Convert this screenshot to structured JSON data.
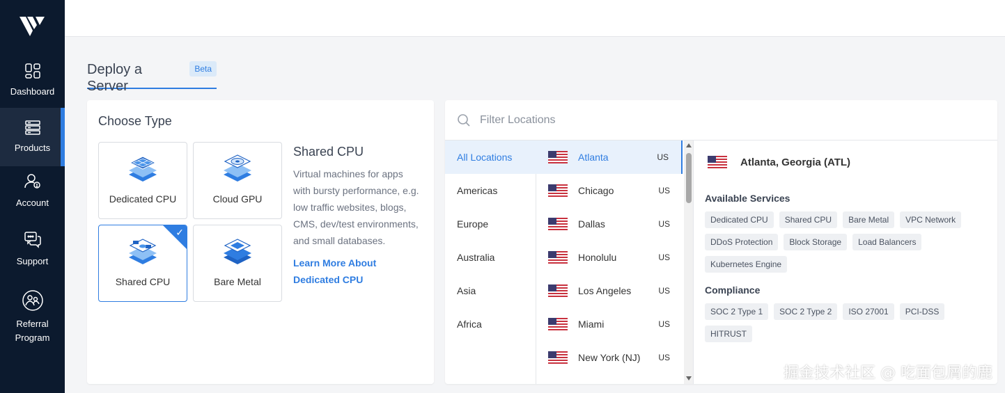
{
  "sidebar": {
    "logo": "vultr-logo",
    "items": [
      {
        "label": "Dashboard",
        "icon": "dashboard-icon"
      },
      {
        "label": "Products",
        "icon": "products-icon",
        "active": true
      },
      {
        "label": "Account",
        "icon": "account-icon"
      },
      {
        "label": "Support",
        "icon": "support-icon"
      },
      {
        "label": "Referral Program",
        "icon": "referral-icon"
      }
    ]
  },
  "page": {
    "title": "Deploy a Server",
    "badge": "Beta"
  },
  "choose_type": {
    "heading": "Choose Type",
    "types": [
      {
        "label": "Dedicated CPU",
        "icon": "dedicated-cpu-icon"
      },
      {
        "label": "Cloud GPU",
        "icon": "cloud-gpu-icon"
      },
      {
        "label": "Shared CPU",
        "icon": "shared-cpu-icon",
        "selected": true
      },
      {
        "label": "Bare Metal",
        "icon": "bare-metal-icon"
      }
    ],
    "description_title": "Shared CPU",
    "description": "Virtual machines for apps with bursty performance, e.g. low traffic websites, blogs, CMS, dev/test environments, and small databases.",
    "learn_more": "Learn More About Dedicated CPU"
  },
  "locations": {
    "filter_placeholder": "Filter Locations",
    "regions": [
      "All Locations",
      "Americas",
      "Europe",
      "Australia",
      "Asia",
      "Africa"
    ],
    "active_region": "All Locations",
    "cities": [
      {
        "name": "Atlanta",
        "country": "US"
      },
      {
        "name": "Chicago",
        "country": "US"
      },
      {
        "name": "Dallas",
        "country": "US"
      },
      {
        "name": "Honolulu",
        "country": "US"
      },
      {
        "name": "Los Angeles",
        "country": "US"
      },
      {
        "name": "Miami",
        "country": "US"
      },
      {
        "name": "New York (NJ)",
        "country": "US"
      }
    ],
    "selected_city": "Atlanta",
    "detail": {
      "title": "Atlanta, Georgia (ATL)",
      "services_heading": "Available Services",
      "services": [
        "Dedicated CPU",
        "Shared CPU",
        "Bare Metal",
        "VPC Network",
        "DDoS Protection",
        "Block Storage",
        "Load Balancers",
        "Kubernetes Engine"
      ],
      "compliance_heading": "Compliance",
      "compliance": [
        "SOC 2 Type 1",
        "SOC 2 Type 2",
        "ISO 27001",
        "PCI-DSS",
        "HITRUST"
      ]
    }
  },
  "watermark": "掘金技术社区 @ 吃面包屑的鹿",
  "colors": {
    "accent": "#2f7de1",
    "sidebar": "#0c1a2e",
    "sidebar_active": "#1d2b40"
  }
}
